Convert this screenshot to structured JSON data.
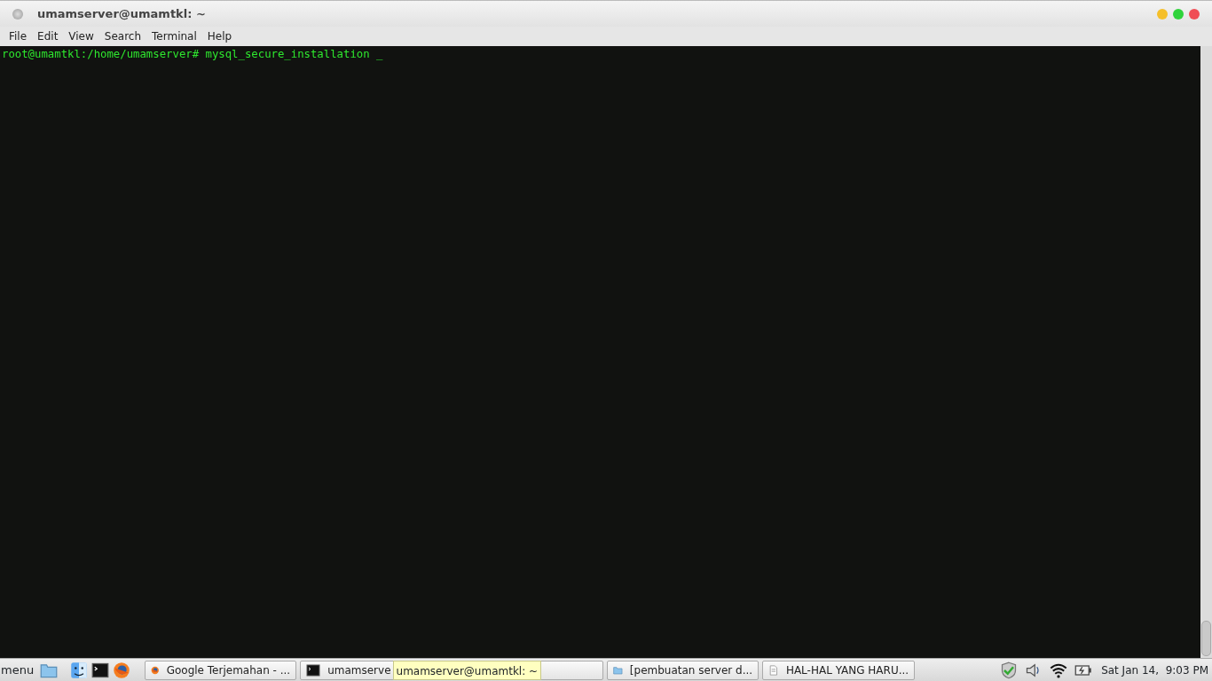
{
  "window": {
    "title": "umamserver@umamtkl: ~"
  },
  "menu": [
    "File",
    "Edit",
    "View",
    "Search",
    "Terminal",
    "Help"
  ],
  "terminal": {
    "lines": [
      "root@umamtkl:/home/umamserver# mysql_secure_installation _"
    ]
  },
  "taskbar": {
    "menu_label": "menu",
    "launchers": [
      {
        "kind": "folder"
      },
      {
        "kind": "finder"
      },
      {
        "kind": "terminal"
      },
      {
        "kind": "firefox"
      }
    ],
    "windows": [
      {
        "kind": "firefox",
        "label": "Google Terjemahan - ..."
      },
      {
        "kind": "terminal",
        "label": "umamserve"
      },
      {
        "kind": "folder",
        "label": "[pembuatan server d..."
      },
      {
        "kind": "document",
        "label": "HAL-HAL YANG HARU..."
      }
    ],
    "tooltip": "umamserver@umamtkl: ~",
    "clock": "Sat Jan 14,  9:03 PM"
  }
}
